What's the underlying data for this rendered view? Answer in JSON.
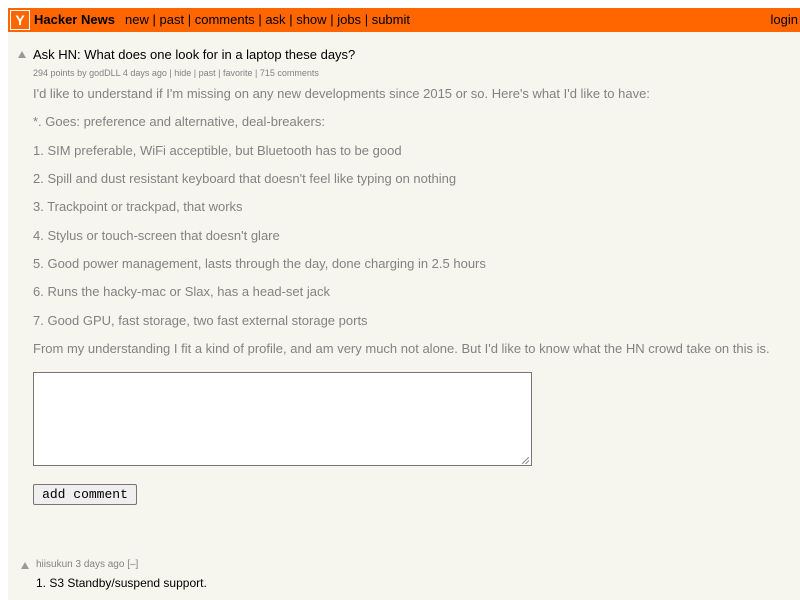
{
  "header": {
    "logo_letter": "Y",
    "site_name": "Hacker News",
    "nav": [
      "new",
      "past",
      "comments",
      "ask",
      "show",
      "jobs",
      "submit"
    ],
    "separator": "|",
    "login": "login",
    "brand_color": "#ff6600"
  },
  "post": {
    "title": "Ask HN: What does one look for in a laptop these days?",
    "points": "294 points",
    "by": "by",
    "author": "godDLL",
    "age": "4 days ago",
    "sep": "|",
    "actions": [
      "hide",
      "past",
      "favorite"
    ],
    "comments_link": "715 comments",
    "body": [
      "I'd like to understand if I'm missing on any new developments since 2015 or so. Here's what I'd like to have:",
      "*. Goes: preference and alternative, deal-breakers:",
      "1. SIM preferable, WiFi acceptible, but Bluetooth has to be good",
      "2. Spill and dust resistant keyboard that doesn't feel like typing on nothing",
      "3. Trackpoint or trackpad, that works",
      "4. Stylus or touch-screen that doesn't glare",
      "5. Good power management, lasts through the day, done charging in 2.5 hours",
      "6. Runs the hacky-mac or Slax, has a head-set jack",
      "7. Good GPU, fast storage, two fast external storage ports",
      "From my understanding I fit a kind of profile, and am very much not alone. But I'd like to know what the HN crowd take on this is."
    ]
  },
  "comment_form": {
    "value": "",
    "button_label": "add comment"
  },
  "comments": [
    {
      "author": "hiisukun",
      "age": "3 days ago",
      "toggle": "[–]",
      "text": "1. S3 Standby/suspend support."
    }
  ]
}
